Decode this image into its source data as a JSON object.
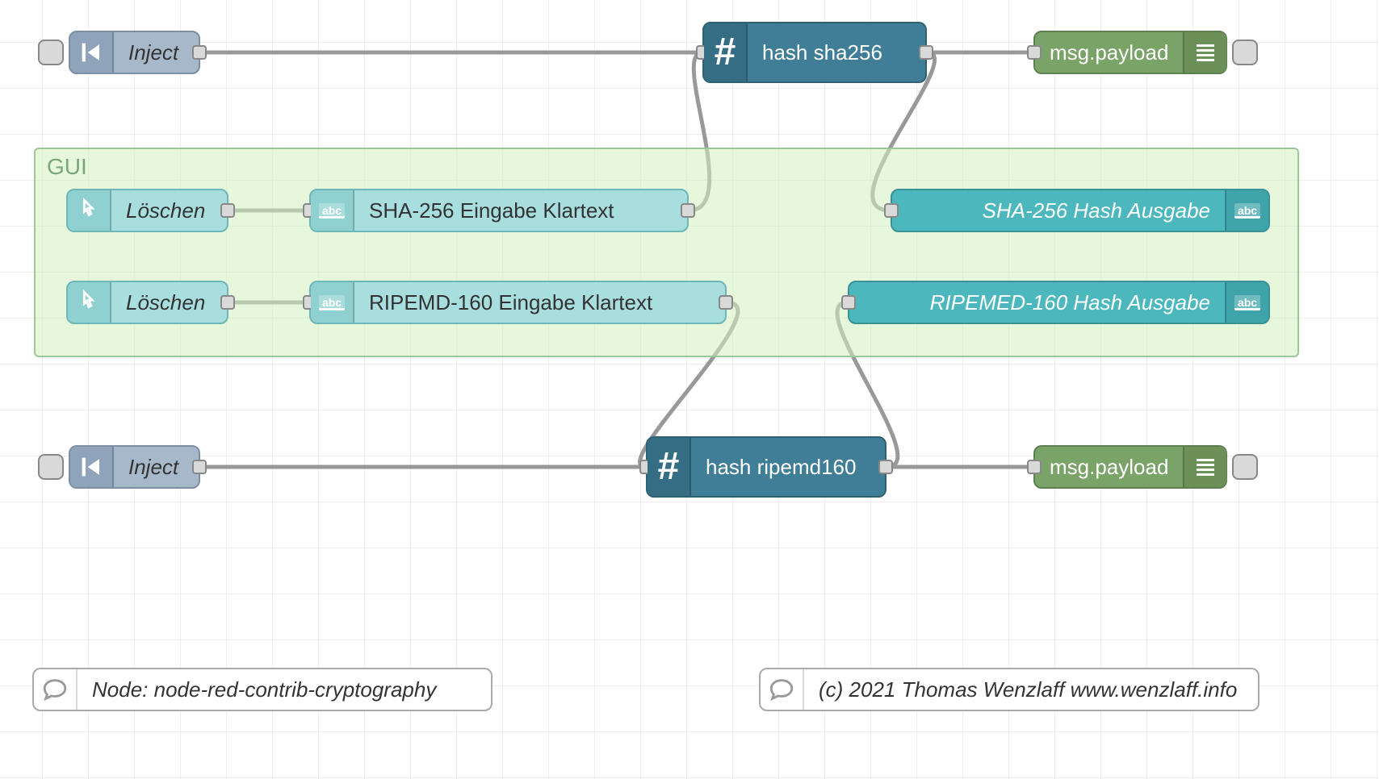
{
  "group": {
    "label": "GUI"
  },
  "nodes": {
    "inject1": {
      "label": "Inject"
    },
    "inject2": {
      "label": "Inject"
    },
    "hash1": {
      "label": "hash sha256"
    },
    "hash2": {
      "label": "hash ripemd160"
    },
    "debug1": {
      "label": "msg.payload"
    },
    "debug2": {
      "label": "msg.payload"
    },
    "btn1": {
      "label": "Löschen"
    },
    "btn2": {
      "label": "Löschen"
    },
    "txt1": {
      "label": "SHA-256 Eingabe Klartext"
    },
    "txt2": {
      "label": "RIPEMD-160 Eingabe Klartext"
    },
    "out1": {
      "label": "SHA-256 Hash Ausgabe"
    },
    "out2": {
      "label": "RIPEMED-160 Hash Ausgabe"
    }
  },
  "comments": {
    "c1": "Node: node-red-contrib-cryptography",
    "c2": "(c) 2021 Thomas Wenzlaff www.wenzlaff.info"
  },
  "icons": {
    "abc": "abc"
  }
}
